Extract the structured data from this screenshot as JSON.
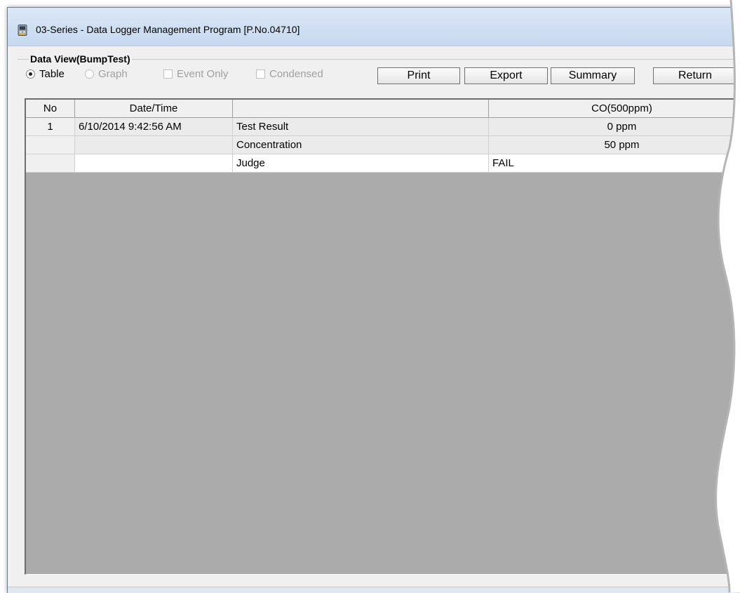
{
  "window": {
    "title": "03-Series  - Data Logger Management Program [P.No.04710]"
  },
  "view": {
    "group_title": "Data View(BumpTest)",
    "options": {
      "table": "Table",
      "graph": "Graph",
      "event_only": "Event Only",
      "condensed": "Condensed"
    },
    "selected_mode": "Table",
    "buttons": {
      "print": "Print",
      "export": "Export",
      "summary": "Summary",
      "return": "Return"
    }
  },
  "table": {
    "headers": [
      "No",
      "Date/Time",
      "",
      "CO(500ppm)"
    ],
    "rows": [
      {
        "no": "1",
        "datetime": "6/10/2014 9:42:56 AM",
        "item": "Test Result",
        "co": "0 ppm"
      },
      {
        "no": "",
        "datetime": "",
        "item": "Concentration",
        "co": "50 ppm"
      },
      {
        "no": "",
        "datetime": "",
        "item": "Judge",
        "co": "FAIL"
      }
    ]
  },
  "icons": {
    "app": "logger-device-icon"
  },
  "colors": {
    "titlebar": "#c6d9f0",
    "grid_background": "#ababab",
    "disabled_text": "#a0a0a0"
  }
}
